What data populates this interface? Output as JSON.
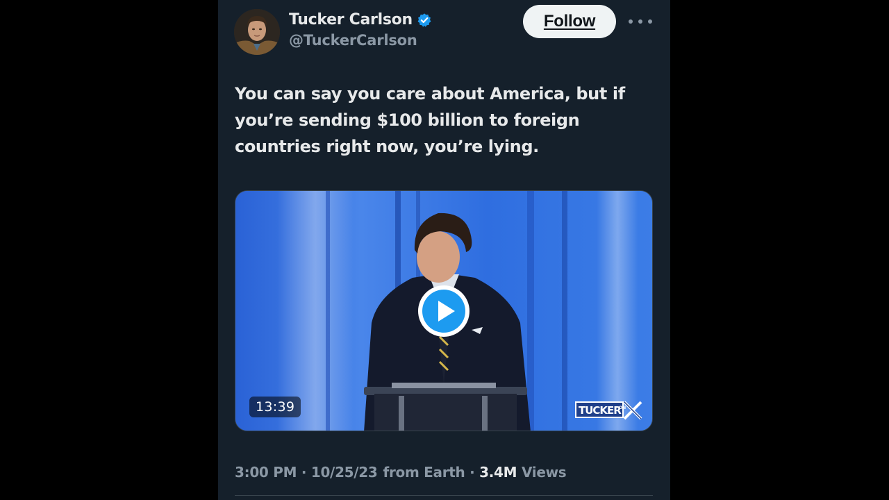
{
  "author": {
    "name": "Tucker Carlson",
    "handle": "@TuckerCarlson",
    "verified": true
  },
  "actions": {
    "follow_label": "Follow",
    "more_icon": "more-horizontal-icon"
  },
  "tweet": {
    "text": "You can say you care about America, but if you’re sending $100 billion to foreign countries right now, you’re lying."
  },
  "media": {
    "type": "video",
    "duration": "13:39",
    "watermark": "TUCKER ON X",
    "play_icon": "play-icon"
  },
  "meta": {
    "time": "3:00 PM",
    "separator": "·",
    "date": "10/25/23",
    "location": "from Earth",
    "views_count": "3.4M",
    "views_label": "Views"
  },
  "colors": {
    "background": "#15202b",
    "text": "#e7e9ea",
    "secondary": "#8b98a5",
    "verified": "#1d9bf0",
    "follow_bg": "#eff3f4"
  }
}
